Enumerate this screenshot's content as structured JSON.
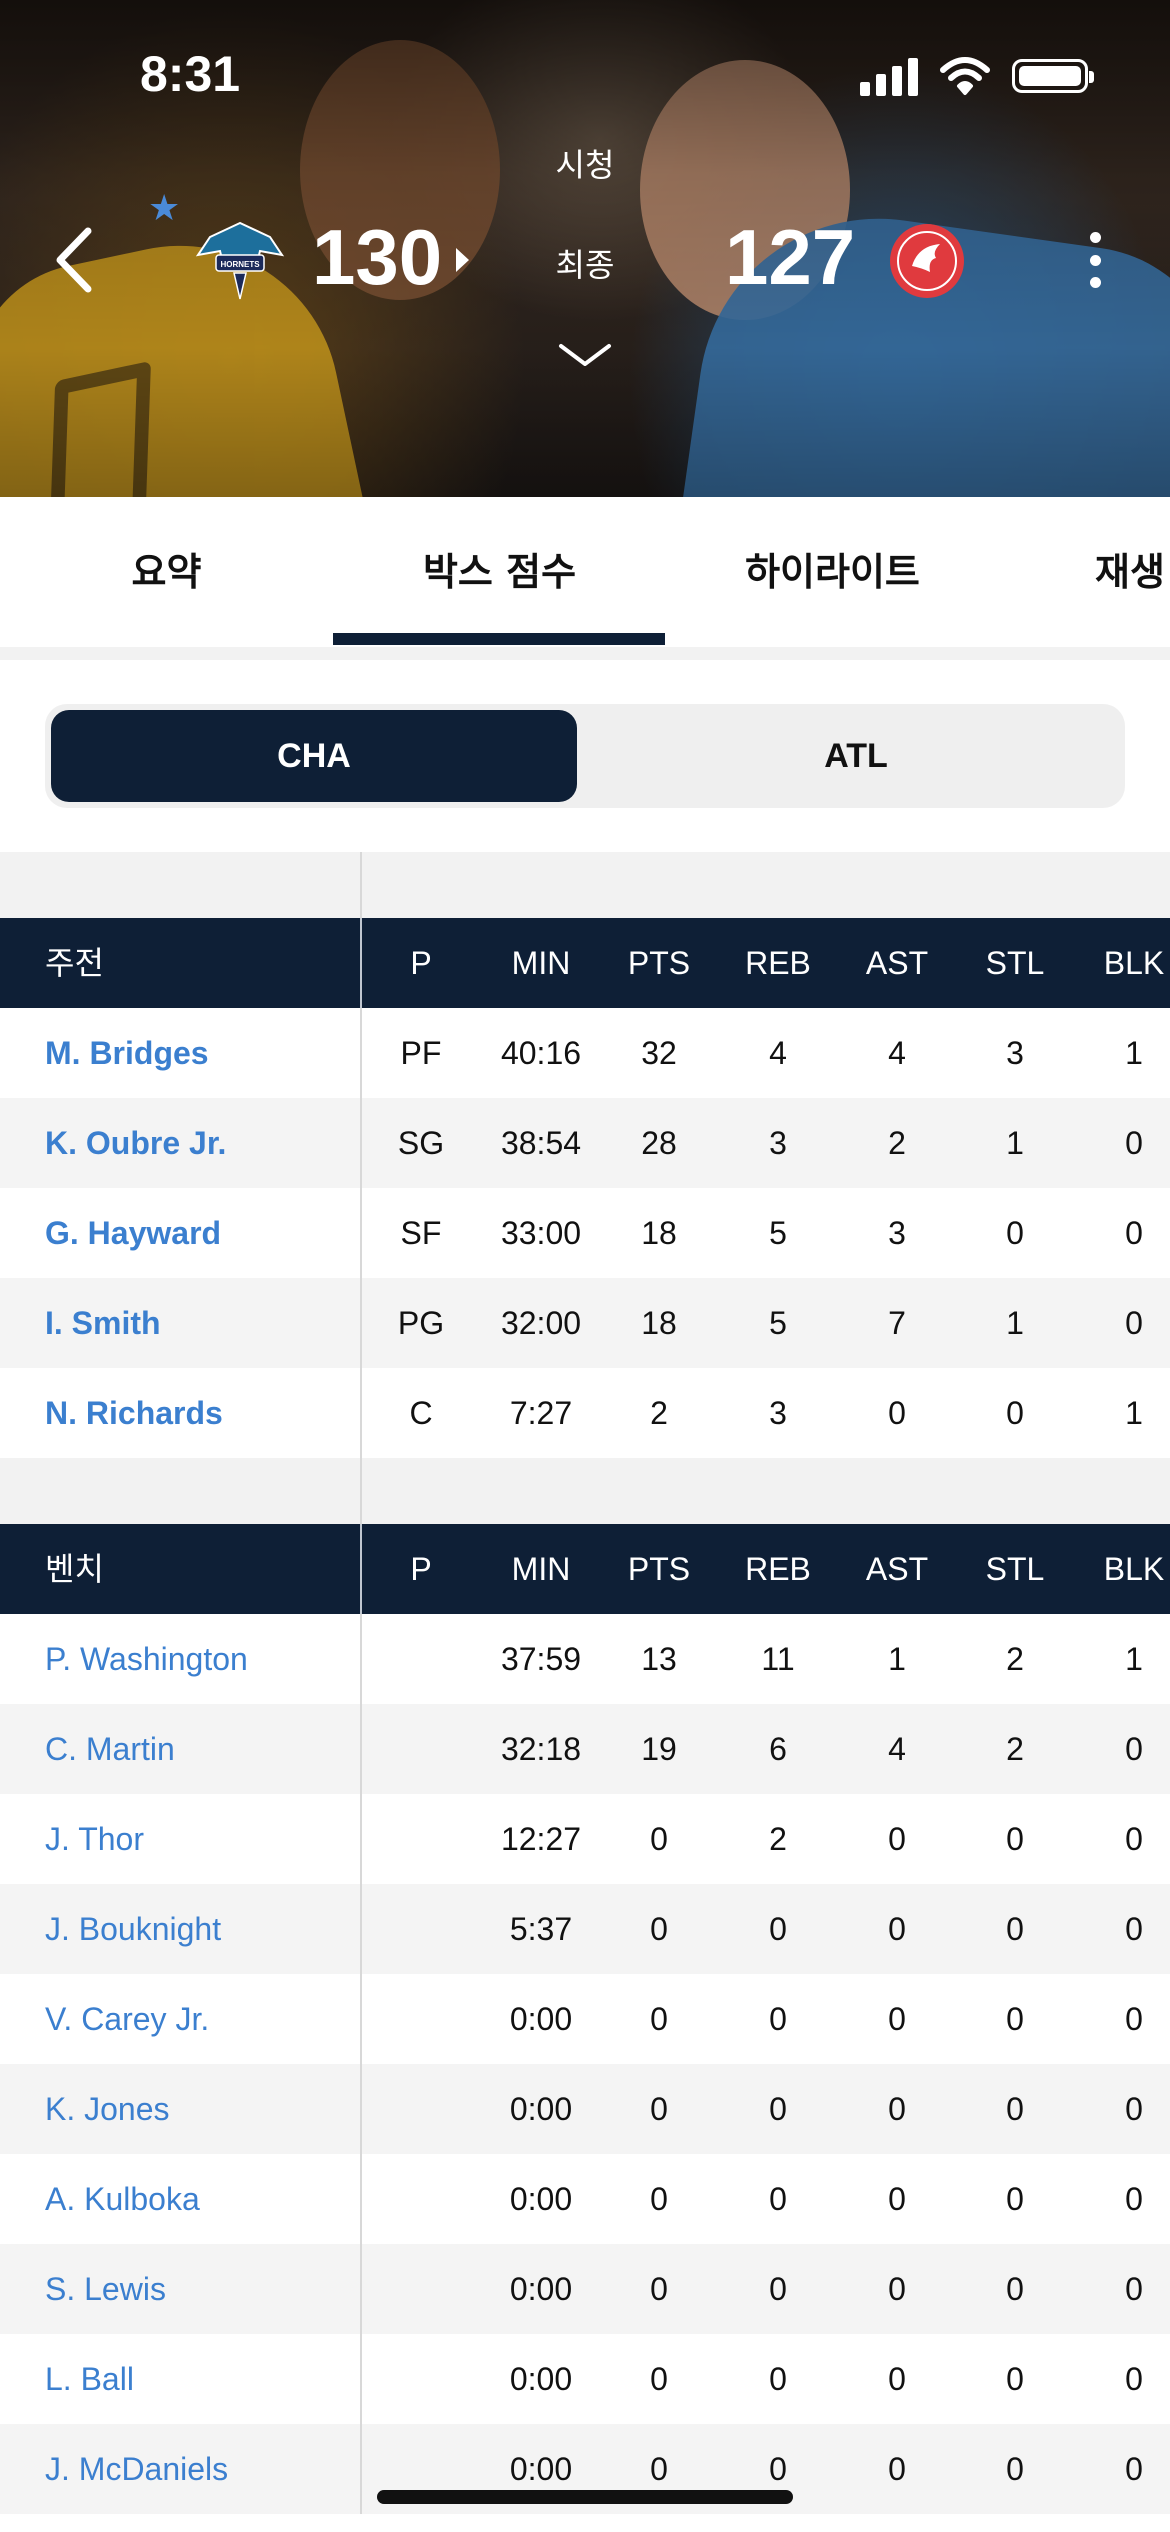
{
  "status_bar": {
    "time": "8:31"
  },
  "game": {
    "home": {
      "abbr": "CHA",
      "score": "130",
      "logo_text": "HORNETS"
    },
    "away": {
      "abbr": "ATL",
      "score": "127"
    },
    "watch_label": "시청",
    "status_label": "최종"
  },
  "tabs": [
    {
      "label": "요약"
    },
    {
      "label": "박스 점수"
    },
    {
      "label": "하이라이트"
    },
    {
      "label": "재생"
    }
  ],
  "team_toggle": {
    "options": [
      "CHA",
      "ATL"
    ],
    "selected": "CHA"
  },
  "columns": [
    "P",
    "MIN",
    "PTS",
    "REB",
    "AST",
    "STL",
    "BLK"
  ],
  "starters": {
    "header": "주전",
    "players": [
      {
        "name": "M. Bridges",
        "stats": [
          "PF",
          "40:16",
          "32",
          "4",
          "4",
          "3",
          "1"
        ]
      },
      {
        "name": "K. Oubre Jr.",
        "stats": [
          "SG",
          "38:54",
          "28",
          "3",
          "2",
          "1",
          "0"
        ]
      },
      {
        "name": "G. Hayward",
        "stats": [
          "SF",
          "33:00",
          "18",
          "5",
          "3",
          "0",
          "0"
        ]
      },
      {
        "name": "I. Smith",
        "stats": [
          "PG",
          "32:00",
          "18",
          "5",
          "7",
          "1",
          "0"
        ]
      },
      {
        "name": "N. Richards",
        "stats": [
          "C",
          "7:27",
          "2",
          "3",
          "0",
          "0",
          "1"
        ]
      }
    ]
  },
  "bench": {
    "header": "벤치",
    "players": [
      {
        "name": "P. Washington",
        "stats": [
          "",
          "37:59",
          "13",
          "11",
          "1",
          "2",
          "1"
        ]
      },
      {
        "name": "C. Martin",
        "stats": [
          "",
          "32:18",
          "19",
          "6",
          "4",
          "2",
          "0"
        ]
      },
      {
        "name": "J. Thor",
        "stats": [
          "",
          "12:27",
          "0",
          "2",
          "0",
          "0",
          "0"
        ]
      },
      {
        "name": "J. Bouknight",
        "stats": [
          "",
          "5:37",
          "0",
          "0",
          "0",
          "0",
          "0"
        ]
      },
      {
        "name": "V. Carey Jr.",
        "stats": [
          "",
          "0:00",
          "0",
          "0",
          "0",
          "0",
          "0"
        ]
      },
      {
        "name": "K. Jones",
        "stats": [
          "",
          "0:00",
          "0",
          "0",
          "0",
          "0",
          "0"
        ]
      },
      {
        "name": "A. Kulboka",
        "stats": [
          "",
          "0:00",
          "0",
          "0",
          "0",
          "0",
          "0"
        ]
      },
      {
        "name": "S. Lewis",
        "stats": [
          "",
          "0:00",
          "0",
          "0",
          "0",
          "0",
          "0"
        ]
      },
      {
        "name": "L. Ball",
        "stats": [
          "",
          "0:00",
          "0",
          "0",
          "0",
          "0",
          "0"
        ]
      },
      {
        "name": "J. McDaniels",
        "stats": [
          "",
          "0:00",
          "0",
          "0",
          "0",
          "0",
          "0"
        ]
      }
    ]
  },
  "colors": {
    "navy": "#0e1f36",
    "link_blue": "#3b7fcf",
    "favorite_star": "#4a8ad8",
    "atl_red": "#e03a3e"
  }
}
